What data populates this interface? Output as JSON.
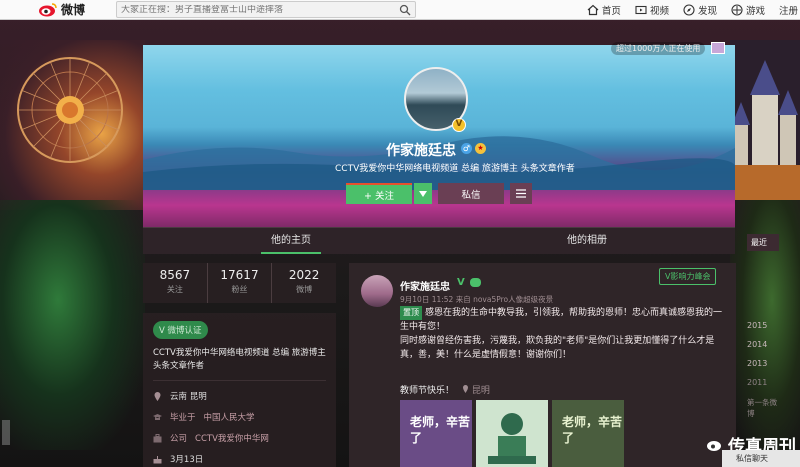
{
  "nav": {
    "logo_text": "微博",
    "search_placeholder": "大家正在搜：男子直播登富士山中途摔落",
    "items": [
      "首页",
      "视频",
      "发现",
      "游戏",
      "注册"
    ]
  },
  "profile": {
    "name": "作家施廷忠",
    "bio": "CCTV我爱你中华网络电视频道 总编 旅游博主 头条文章作者",
    "online_text": "超过1000万人正在使用",
    "follow_label": "+ 关注",
    "message_label": "私信"
  },
  "tabs": [
    "他的主页",
    "他的相册"
  ],
  "stats": [
    {
      "value": "8567",
      "label": "关注"
    },
    {
      "value": "17617",
      "label": "粉丝"
    },
    {
      "value": "2022",
      "label": "微博"
    }
  ],
  "info": {
    "cert": "V 微博认证",
    "description": "CCTV我爱你中华网络电视频道 总编 旅游博主 头条文章作者",
    "location": "云南 昆明",
    "school_prefix": "毕业于",
    "school": "中国人民大学",
    "company_prefix": "公司",
    "company": "CCTV我爱你中华网",
    "birthday": "3月13日"
  },
  "post": {
    "author": "作家施廷忠",
    "badge": "V影响力峰会",
    "meta": "9月10日 11:52 来自 nova5Pro人像超级夜景",
    "tag": "置顶",
    "text1": "感恩在我的生命中教导我，引领我，帮助我的恩师！忠心而真诚感恩我的一生中有您！",
    "text2": "同时感谢曾经伤害我，污蔑我，欺负我的\"老师\"是你们让我更加懂得了什么才是真，善，美！什么是虚情假意！谢谢你们！",
    "footer": "教师节快乐！",
    "location": "昆明",
    "thumb1": "老师，辛苦了",
    "thumb3": "老师，辛苦了"
  },
  "timeline": {
    "current": "最近",
    "years": [
      "2015",
      "2014",
      "2013",
      "2011"
    ],
    "back": "第一条微博"
  },
  "watermark": "传真周刊",
  "chat": "私信聊天"
}
